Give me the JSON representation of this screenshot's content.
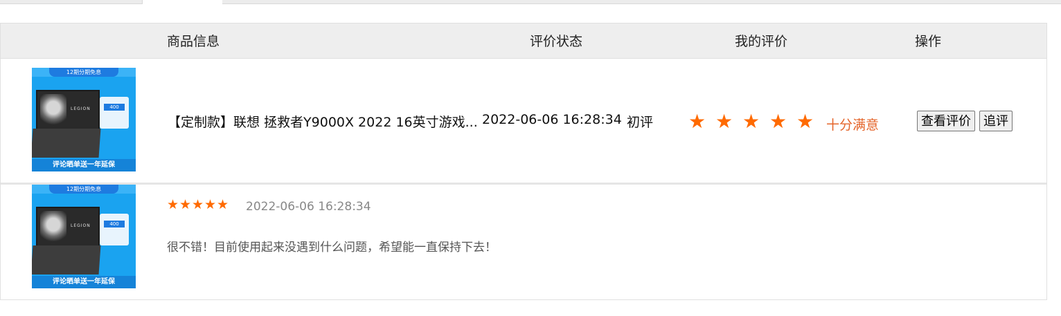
{
  "table": {
    "headers": {
      "info": "商品信息",
      "status": "评价状态",
      "mine": "我的评价",
      "op": "操作"
    }
  },
  "product": {
    "thumb_top_badge": "12期分期免息",
    "thumb_brand": "LEGION",
    "thumb_price_tag": "400",
    "thumb_bottom_text": "评论晒单送一年延保",
    "title": "【定制款】联想 拯救者Y9000X 2022 16英寸游戏...",
    "date": "2022-06-06 16:28:34",
    "status": "初评"
  },
  "my_rating": {
    "stars": 5,
    "max_stars": 5,
    "text": "十分满意",
    "color": "#ff6a00"
  },
  "actions": {
    "view_label": "查看评价",
    "follow_label": "追评"
  },
  "review": {
    "stars": 5,
    "date": "2022-06-06 16:28:34",
    "text": "很不错！目前使用起来没遇到什么问题，希望能一直保持下去！"
  }
}
